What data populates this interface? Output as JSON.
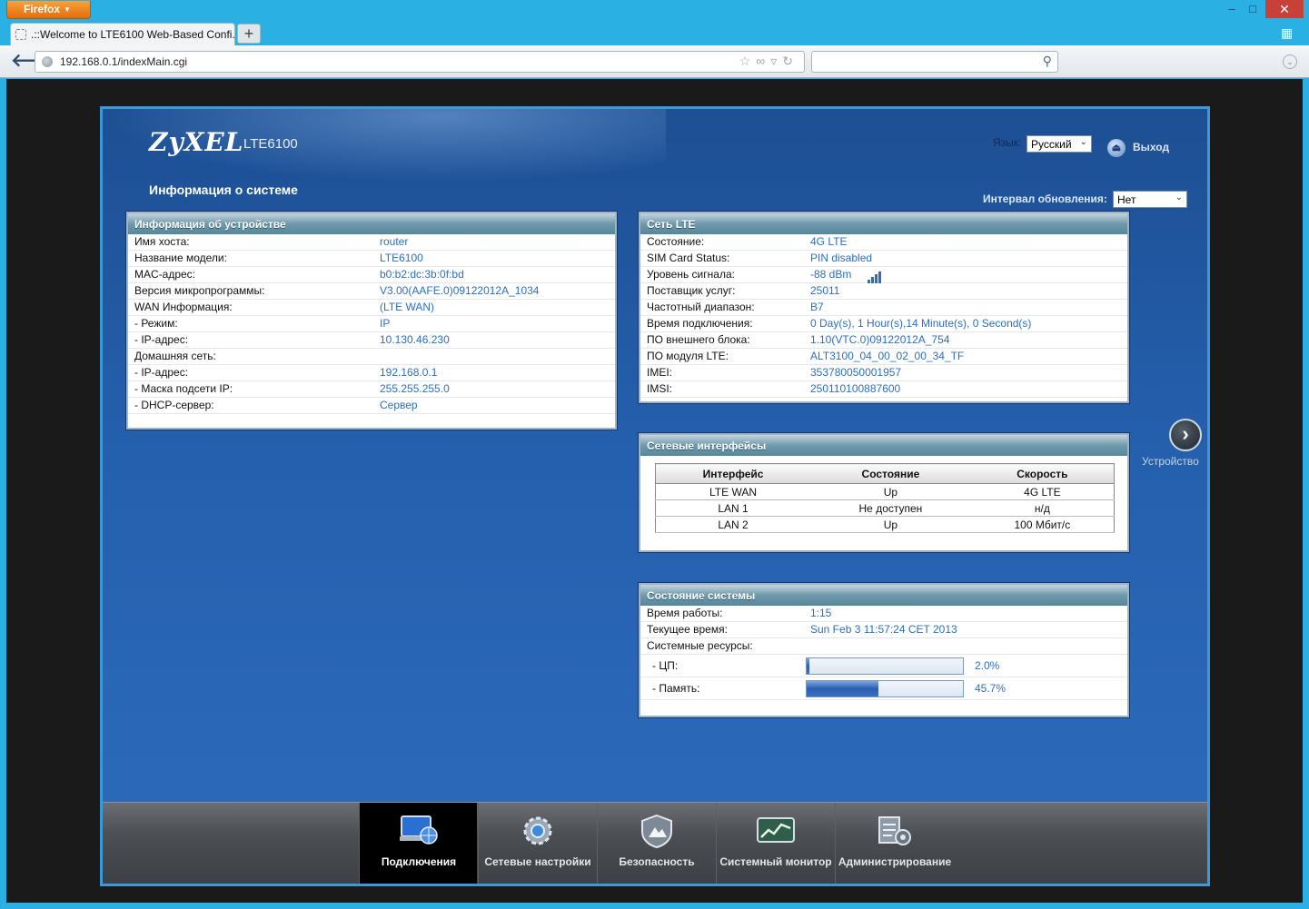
{
  "browser": {
    "menu_button": "Firefox",
    "tab_title": ".::Welcome to LTE6100 Web-Based Confi...",
    "new_tab": "+",
    "url": "192.168.0.1/indexMain.cgi",
    "back_icon": "arrow-left-icon",
    "win_min": "–",
    "win_max": "□",
    "win_close": "✕"
  },
  "header": {
    "logo": "ZyXEL",
    "model": "LTE6100",
    "page_title": "Информация о системе",
    "language_label": "Язык:",
    "language_value": "Русский",
    "logout": "Выход",
    "refresh_label": "Интервал обновления:",
    "refresh_value": "Нет"
  },
  "device_info": {
    "title": "Информация об устройстве",
    "rows": [
      {
        "label": "Имя хоста:",
        "value": "router"
      },
      {
        "label": "Название модели:",
        "value": "LTE6100"
      },
      {
        "label": "MAC-адрес:",
        "value": "b0:b2:dc:3b:0f:bd"
      },
      {
        "label": "Версия микропрограммы:",
        "value": "V3.00(AAFE.0)09122012A_1034"
      },
      {
        "label": "WAN Информация:",
        "value": " (LTE WAN)"
      },
      {
        "label": " - Режим:",
        "value": "IP"
      },
      {
        "label": " - IP-адрес:",
        "value": "10.130.46.230"
      },
      {
        "label": "Домашняя сеть:",
        "value": ""
      },
      {
        "label": " - IP-адрес:",
        "value": "192.168.0.1"
      },
      {
        "label": " - Маска подсети IP:",
        "value": "255.255.255.0"
      },
      {
        "label": " - DHCP-сервер:",
        "value": "Сервер"
      }
    ]
  },
  "lte": {
    "title": "Сеть LTE",
    "rows": [
      {
        "label": "Состояние:",
        "value": "4G LTE"
      },
      {
        "label": "SIM Card Status:",
        "value": "PIN disabled"
      },
      {
        "label": "Уровень сигнала:",
        "value": "-88 dBm"
      },
      {
        "label": "Поставщик услуг:",
        "value": "25011"
      },
      {
        "label": "Частотный диапазон:",
        "value": "B7"
      },
      {
        "label": "Время подключения:",
        "value": "0 Day(s), 1 Hour(s),14 Minute(s), 0 Second(s)"
      },
      {
        "label": "ПО внешнего блока:",
        "value": "1.10(VTC.0)09122012A_754"
      },
      {
        "label": "ПО модуля LTE:",
        "value": "ALT3100_04_00_02_00_34_TF"
      },
      {
        "label": "IMEI:",
        "value": "353780050001957"
      },
      {
        "label": "IMSI:",
        "value": "250110100887600"
      }
    ],
    "signal_icon": "signal-bars-icon"
  },
  "interfaces": {
    "title": "Сетевые интерфейсы",
    "columns": [
      "Интерфейс",
      "Состояние",
      "Скорость"
    ],
    "rows": [
      [
        "LTE WAN",
        "Up",
        "4G LTE"
      ],
      [
        "LAN 1",
        "Не доступен",
        "н/д"
      ],
      [
        "LAN 2",
        "Up",
        "100 Мбит/с"
      ]
    ]
  },
  "system": {
    "title": "Состояние системы",
    "uptime_label": "Время работы:",
    "uptime": "1:15",
    "time_label": "Текущее время:",
    "time": "Sun Feb 3 11:57:24 CET 2013",
    "resources_label": "Системные ресурсы:",
    "cpu_label": " - ЦП:",
    "cpu_text": "2.0%",
    "cpu_fraction": 0.02,
    "mem_label": " - Память:",
    "mem_text": "45.7%",
    "mem_fraction": 0.457
  },
  "side_nav": {
    "next_label": "Устройство",
    "icon": "chevron-right-icon"
  },
  "bottom_nav": [
    {
      "label": "Подключения",
      "icon": "network-monitor-icon",
      "active": true
    },
    {
      "label": "Сетевые настройки",
      "icon": "gear-icon",
      "active": false
    },
    {
      "label": "Безопасность",
      "icon": "shield-icon",
      "active": false
    },
    {
      "label": "Системный монитор",
      "icon": "chart-monitor-icon",
      "active": false
    },
    {
      "label": "Администрирование",
      "icon": "admin-tools-icon",
      "active": false
    }
  ]
}
